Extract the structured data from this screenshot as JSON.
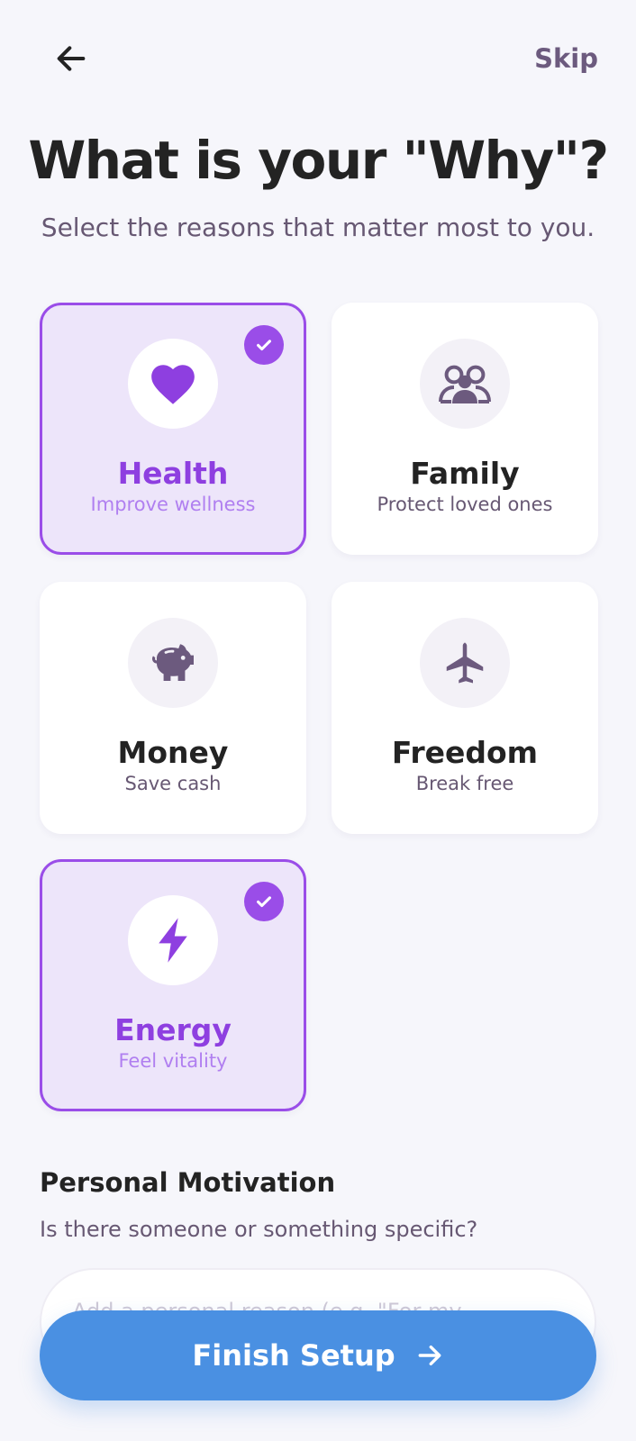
{
  "header": {
    "back_icon": "arrow-left-icon",
    "skip_label": "Skip"
  },
  "title": "What is your \"Why\"?",
  "subtitle": "Select the reasons that matter most to you.",
  "reasons": [
    {
      "label": "Health",
      "description": "Improve wellness",
      "icon": "heart-icon",
      "selected": true
    },
    {
      "label": "Family",
      "description": "Protect loved ones",
      "icon": "people-group-icon",
      "selected": false
    },
    {
      "label": "Money",
      "description": "Save cash",
      "icon": "piggy-bank-icon",
      "selected": false
    },
    {
      "label": "Freedom",
      "description": "Break free",
      "icon": "airplane-icon",
      "selected": false
    },
    {
      "label": "Energy",
      "description": "Feel vitality",
      "icon": "lightning-bolt-icon",
      "selected": true
    }
  ],
  "personal": {
    "title": "Personal Motivation",
    "subtitle": "Is there someone or something specific?",
    "placeholder": "Add a personal reason (e.g. \"For my..."
  },
  "finish": {
    "label": "Finish Setup",
    "icon": "arrow-right-icon"
  },
  "colors": {
    "accent_purple": "#9a4de8",
    "selected_bg": "#ede5fa",
    "icon_muted": "#6c5a7e",
    "primary_blue": "#4a90e2",
    "page_bg": "#f6f6fb"
  }
}
